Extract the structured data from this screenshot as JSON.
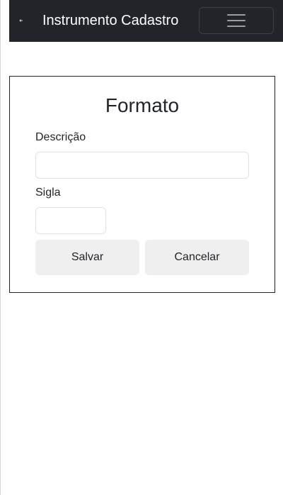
{
  "navbar": {
    "back_icon": "arrow-left-icon",
    "brand": "Instrumento Cadastro",
    "toggler_icon": "hamburger-menu-icon",
    "background": "#212529"
  },
  "form": {
    "title": "Formato",
    "descricao_label": "Descrição",
    "descricao_value": "",
    "sigla_label": "Sigla",
    "sigla_value": "",
    "save_label": "Salvar",
    "cancel_label": "Cancelar"
  },
  "colors": {
    "button_background": "#efefef",
    "input_border": "#dee2e6",
    "card_border": "#222222"
  }
}
